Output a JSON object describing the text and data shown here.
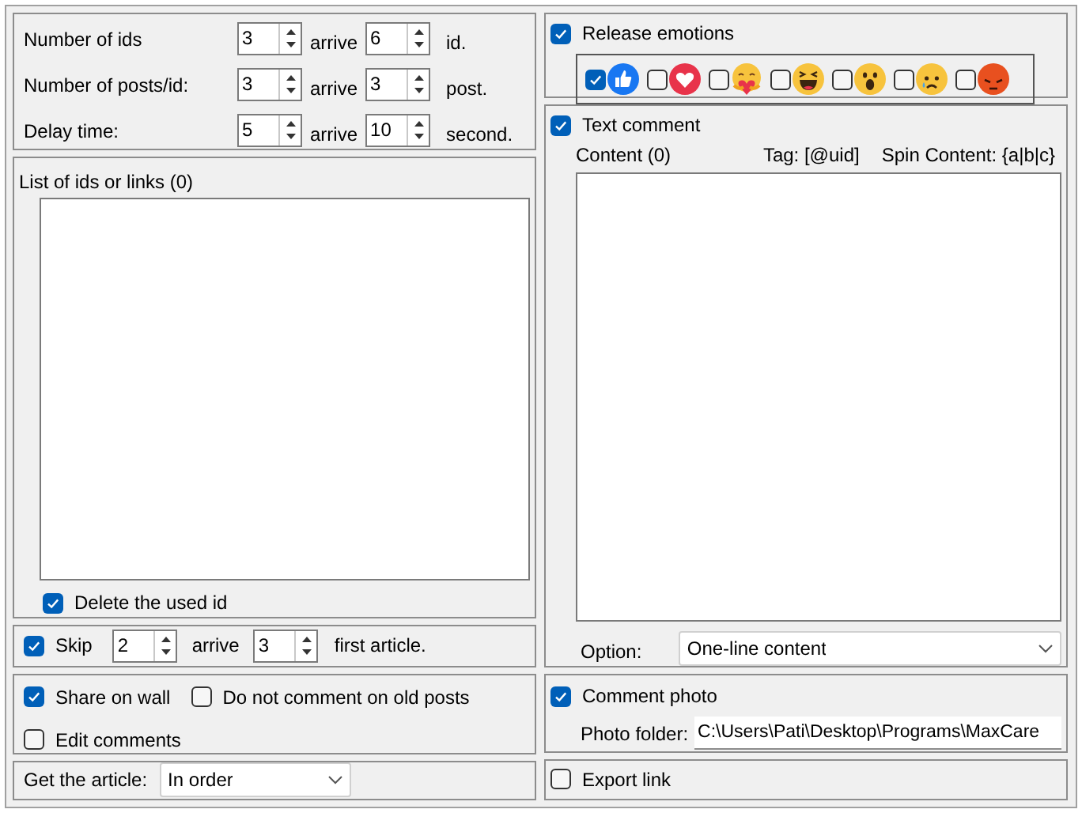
{
  "counts": [
    {
      "label": "Number of ids",
      "from": "3",
      "arrive": "arrive",
      "to": "6",
      "unit": "id."
    },
    {
      "label": "Number of posts/id:",
      "from": "3",
      "arrive": "arrive",
      "to": "3",
      "unit": "post."
    },
    {
      "label": "Delay time:",
      "from": "5",
      "arrive": "arrive",
      "to": "10",
      "unit": "second."
    }
  ],
  "id_list": {
    "title": "List of ids or links (0)",
    "delete_used": {
      "label": "Delete the used id",
      "checked": true
    }
  },
  "skip": {
    "label": "Skip",
    "checked": true,
    "from": "2",
    "arrive": "arrive",
    "to": "3",
    "unit": "first article."
  },
  "options": [
    {
      "label": "Share on wall",
      "checked": true
    },
    {
      "label": "Do not comment on old posts",
      "checked": false
    },
    {
      "label": "Edit comments",
      "checked": false
    }
  ],
  "get_article": {
    "label": "Get the article:",
    "value": "In order"
  },
  "release_emotions": {
    "label": "Release emotions",
    "checked": true,
    "reactions": [
      {
        "kind": "like",
        "checked": true
      },
      {
        "kind": "love",
        "checked": false
      },
      {
        "kind": "care",
        "checked": false
      },
      {
        "kind": "haha",
        "checked": false
      },
      {
        "kind": "wow",
        "checked": false
      },
      {
        "kind": "sad",
        "checked": false
      },
      {
        "kind": "angry",
        "checked": false
      }
    ]
  },
  "text_comment": {
    "label": "Text comment",
    "checked": true,
    "content_label": "Content (0)",
    "tag": "Tag: [@uid]",
    "spin": "Spin Content: {a|b|c}",
    "option_label": "Option:",
    "option_value": "One-line content"
  },
  "comment_photo": {
    "label": "Comment photo",
    "checked": true,
    "folder_label": "Photo folder:",
    "folder_value": "C:\\Users\\Pati\\Desktop\\Programs\\MaxCare"
  },
  "export_link": {
    "label": "Export link",
    "checked": false
  }
}
